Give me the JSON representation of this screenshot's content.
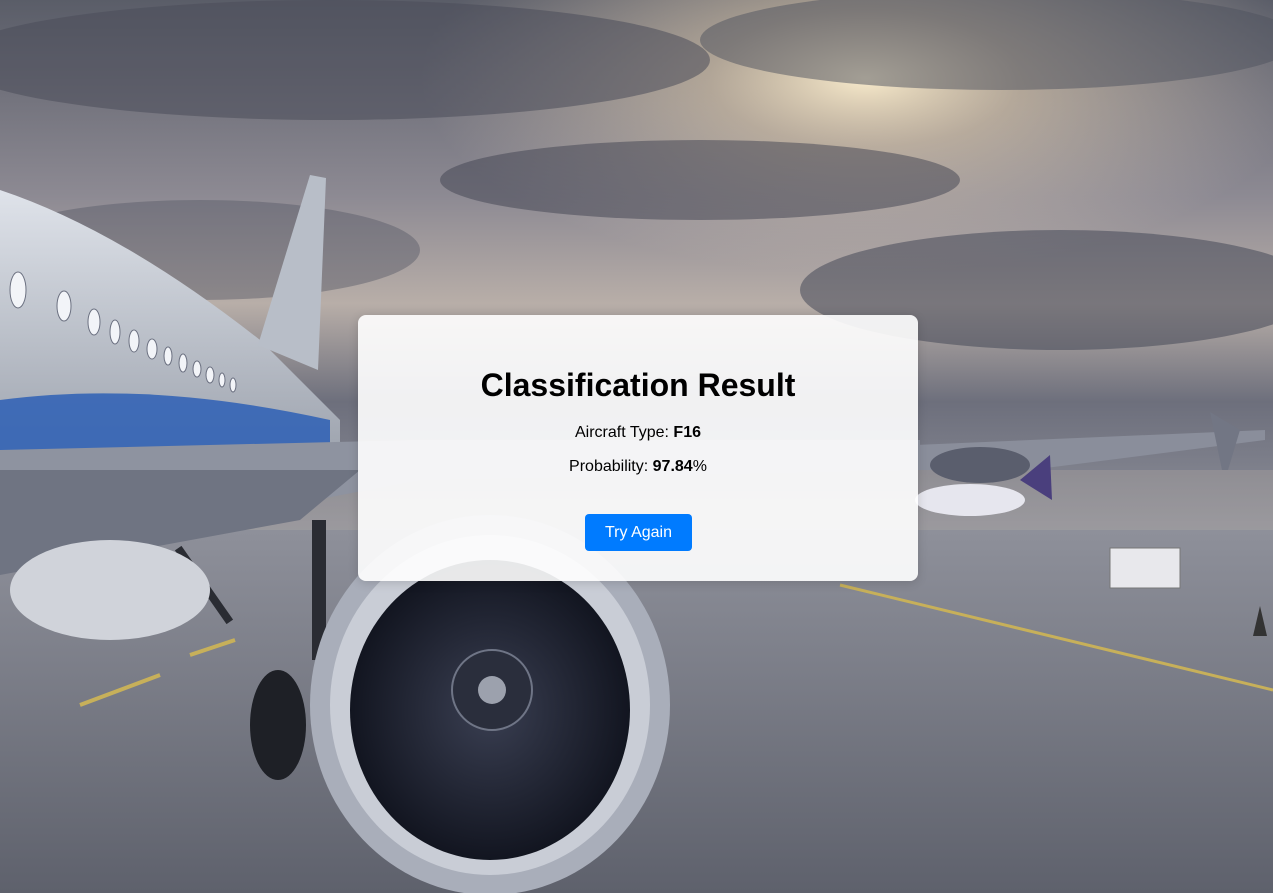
{
  "result": {
    "title": "Classification Result",
    "aircraft_type_label": "Aircraft Type:",
    "aircraft_type_value": "F16",
    "probability_label": "Probability:",
    "probability_value": "97.84",
    "probability_unit": "%"
  },
  "actions": {
    "try_again_label": "Try Again"
  },
  "colors": {
    "button": "#007bff",
    "card": "#ffffff"
  },
  "background": {
    "icon": "airport-tarmac-airplane-photo"
  }
}
